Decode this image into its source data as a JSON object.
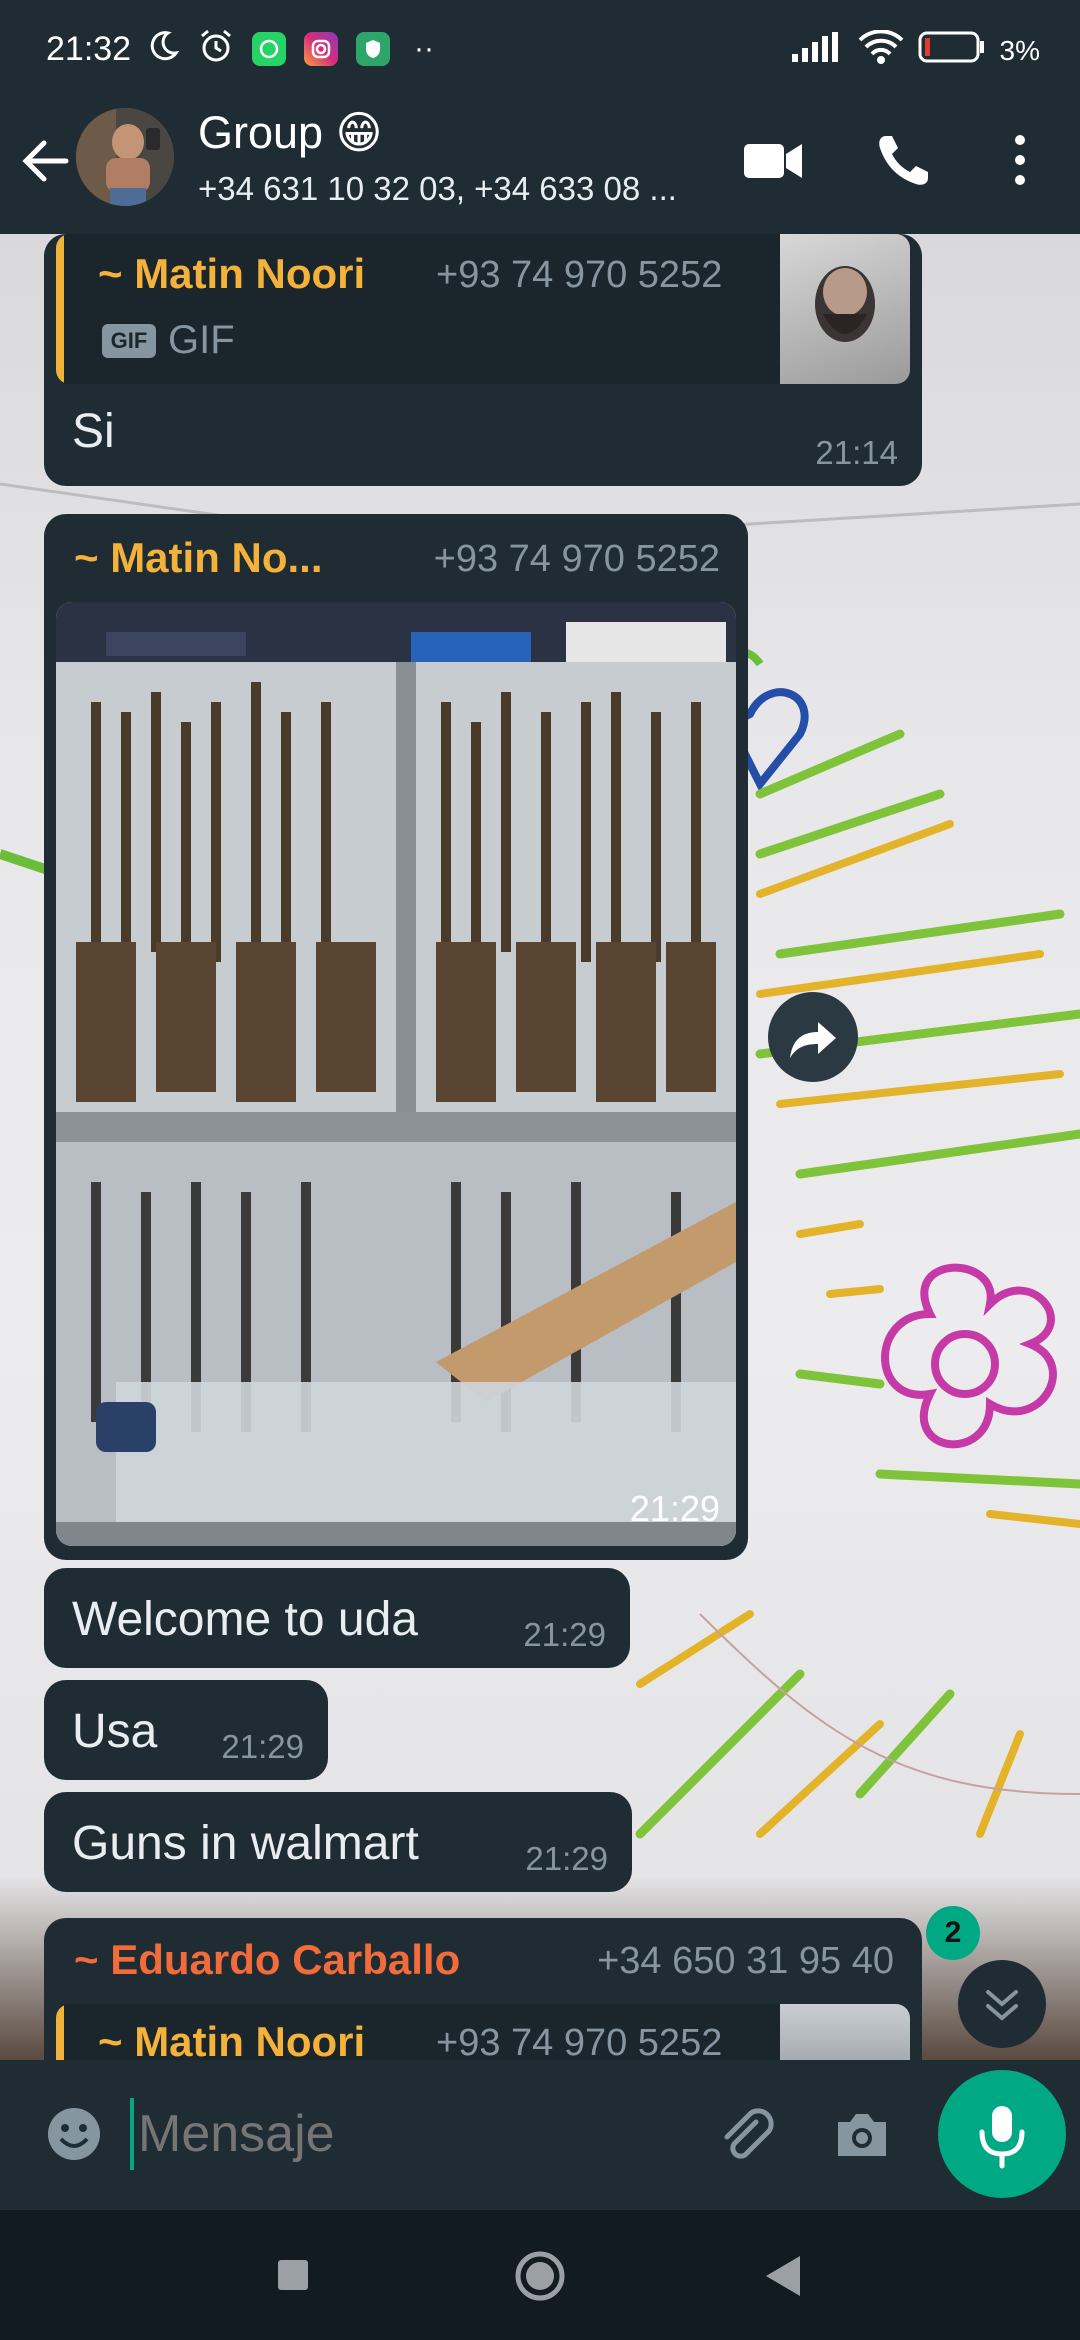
{
  "status_bar": {
    "time": "21:32",
    "battery": "3%",
    "icons": [
      "moon-icon",
      "alarm-icon",
      "whatsapp-icon",
      "instagram-icon",
      "shield-icon",
      "signal-icon",
      "wifi-icon",
      "battery-icon"
    ]
  },
  "header": {
    "title": "Group 😁",
    "subtitle": "+34 631 10 32 03, +34 633 08 ..."
  },
  "messages": {
    "m1": {
      "quote_sender": "~ Matin Noori",
      "quote_phone": "+93 74 970 5252",
      "quote_badge": "GIF",
      "quote_type": "GIF",
      "text": "Si",
      "time": "21:14"
    },
    "m2": {
      "sender": "~ Matin No...",
      "phone": "+93 74 970 5252",
      "time": "21:29"
    },
    "m3": {
      "text": "Welcome to uda",
      "time": "21:29"
    },
    "m4": {
      "text": "Usa",
      "time": "21:29"
    },
    "m5": {
      "text": "Guns in walmart",
      "time": "21:29"
    },
    "m6": {
      "sender": "~ Eduardo Carballo",
      "phone": "+34 650 31 95 40",
      "quote_sender": "~ Matin Noori",
      "quote_phone": "+93 74 970 5252"
    }
  },
  "unread_count": "2",
  "composer": {
    "placeholder": "Mensaje"
  },
  "colors": {
    "accent": "#00a884",
    "bubble": "#1f2c34",
    "sender_yellow": "#f4b23b",
    "sender_orange": "#f26b3a"
  }
}
